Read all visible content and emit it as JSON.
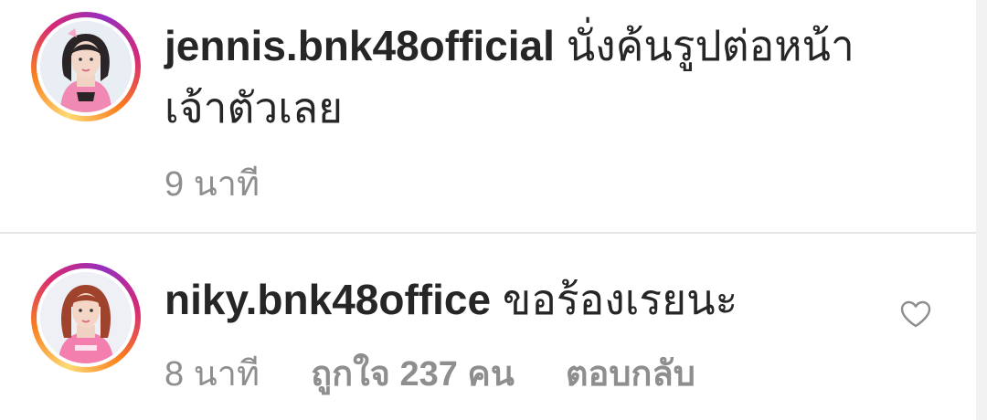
{
  "comments": [
    {
      "username": "jennis.bnk48official",
      "text": "นั่งค้นรูปต่อหน้าเจ้าตัวเลย",
      "time": "9 นาที"
    },
    {
      "username": "niky.bnk48office",
      "text": "ขอร้องเรยนะ",
      "time": "8 นาที",
      "likes": "ถูกใจ 237 คน",
      "reply": "ตอบกลับ",
      "like_icon": "heart-outline-icon"
    }
  ],
  "colors": {
    "text_primary": "#262626",
    "text_secondary": "#8e8e8e",
    "divider": "#e6e6e6",
    "story_ring": [
      "#feda75",
      "#fa7e1e",
      "#d62976",
      "#962fbf"
    ]
  }
}
